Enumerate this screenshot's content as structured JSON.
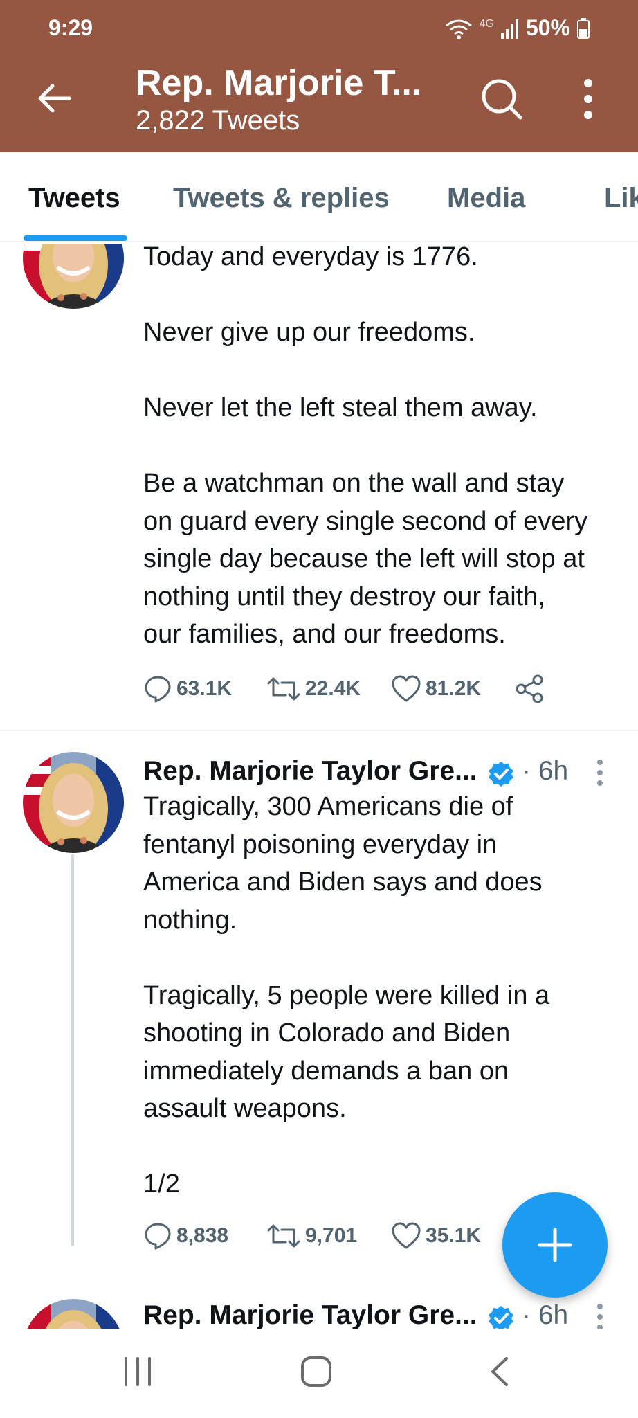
{
  "status_bar": {
    "time": "9:29",
    "network": "4G",
    "battery": "50%"
  },
  "header": {
    "title": "Rep. Marjorie T...",
    "subtitle": "2,822 Tweets",
    "background_color": "#965742"
  },
  "tabs": [
    {
      "label": "Tweets",
      "active": true
    },
    {
      "label": "Tweets & replies",
      "active": false
    },
    {
      "label": "Media",
      "active": false
    },
    {
      "label": "Lik",
      "active": false
    }
  ],
  "tweets": [
    {
      "text": "Today and everyday is 1776.\n\nNever give up our freedoms.\n\nNever let the left steal them away.\n\nBe a watchman on the wall and stay\non guard every single second of every\nsingle day because the left will stop at\nnothing until they destroy our faith,\nour families, and our freedoms.",
      "replies": "63.1K",
      "retweets": "22.4K",
      "likes": "81.2K"
    },
    {
      "author": "Rep. Marjorie Taylor Gre...",
      "time": "· 6h",
      "text": "Tragically, 300 Americans die of\nfentanyl poisoning everyday in\nAmerica and Biden says and does\nnothing.\n\nTragically, 5 people were killed in a\nshooting in Colorado and Biden\nimmediately demands a ban on\nassault weapons.\n\n1/2",
      "replies": "8,838",
      "retweets": "9,701",
      "likes": "35.1K"
    },
    {
      "author": "Rep. Marjorie Taylor Gre...",
      "time": "· 6h"
    }
  ],
  "colors": {
    "accent": "#1d9bf0",
    "secondary_text": "#536471"
  },
  "icons": [
    "back-arrow-icon",
    "search-icon",
    "more-vertical-icon",
    "reply-icon",
    "retweet-icon",
    "like-icon",
    "share-icon",
    "verified-badge-icon",
    "compose-plus-icon",
    "recent-apps-icon",
    "home-icon",
    "nav-back-icon"
  ]
}
